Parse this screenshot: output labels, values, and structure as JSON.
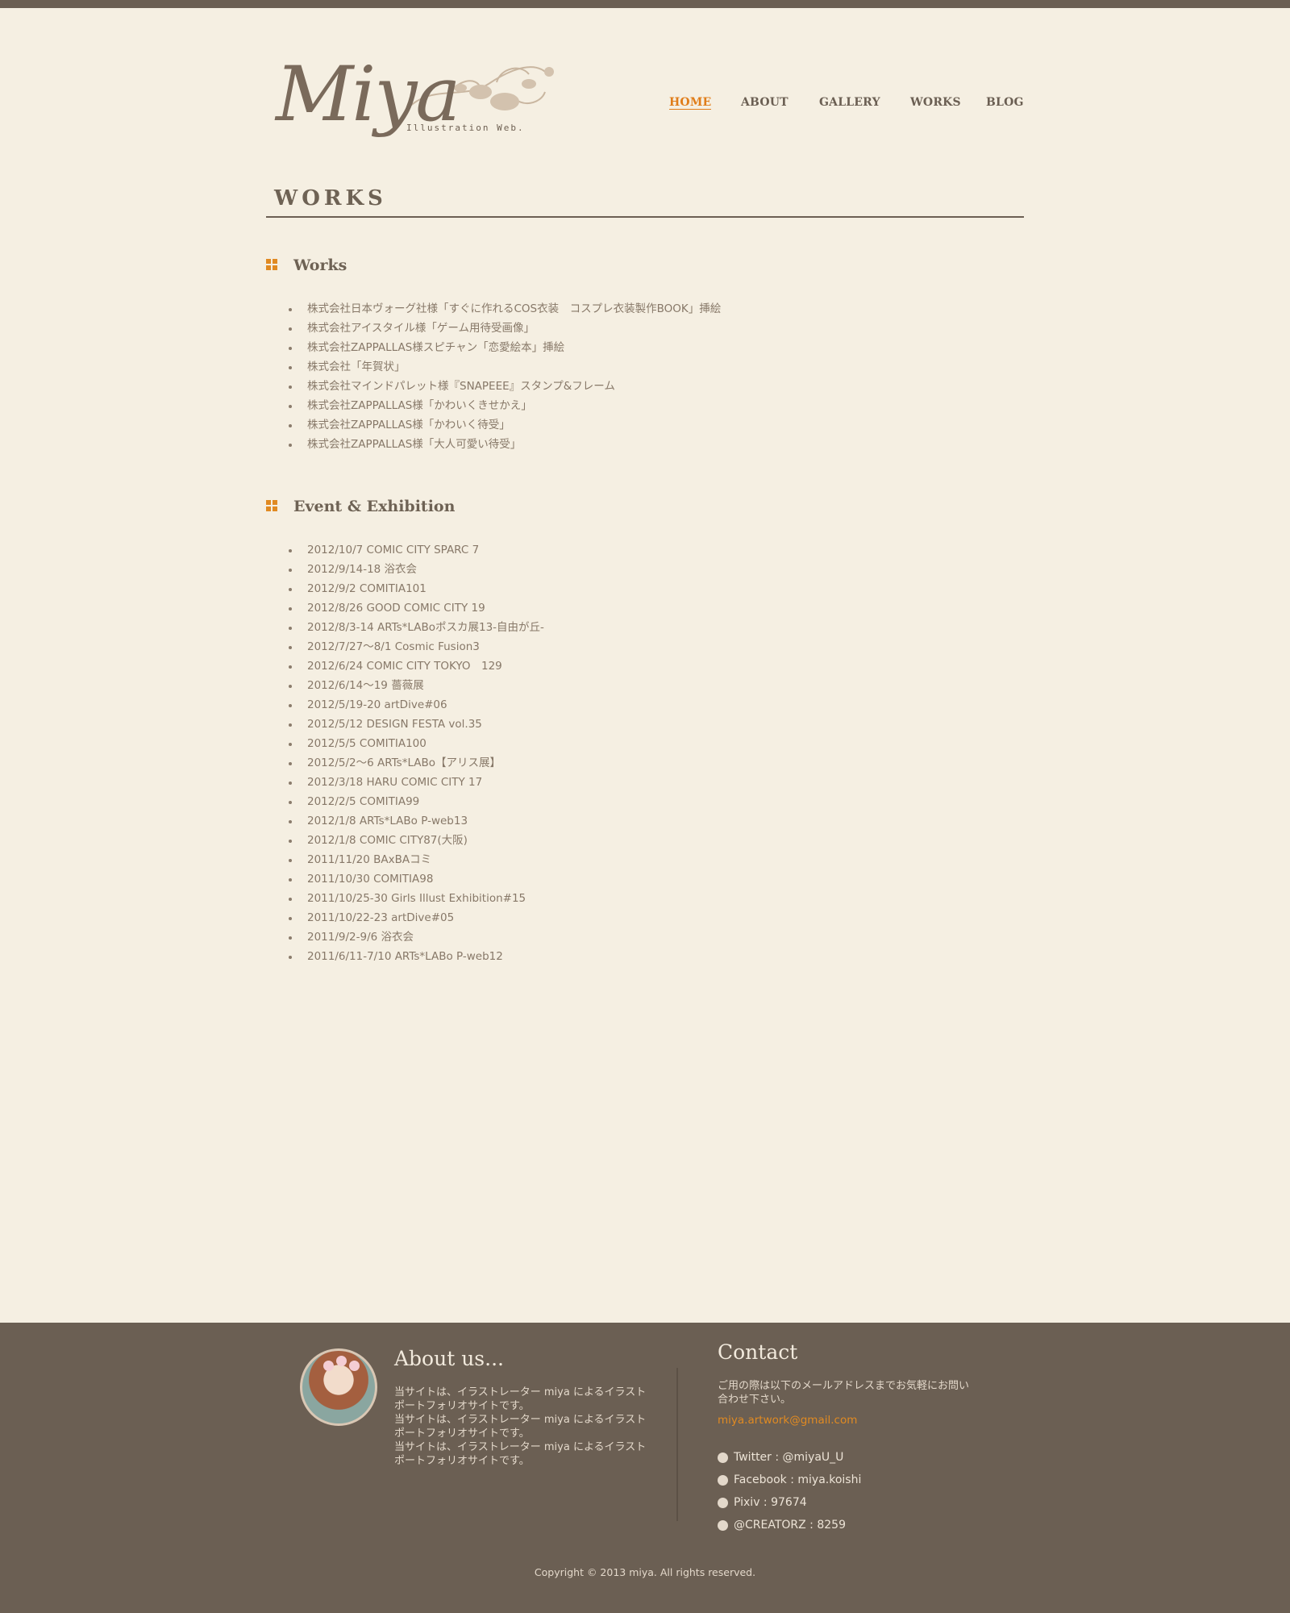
{
  "header": {
    "logo_text": "Miya",
    "logo_subtitle": "Illustration Web."
  },
  "nav": [
    {
      "label": "HOME",
      "active": true
    },
    {
      "label": "ABOUT",
      "active": false
    },
    {
      "label": "GALLERY",
      "active": false
    },
    {
      "label": "WORKS",
      "active": false
    },
    {
      "label": "BLOG",
      "active": false
    }
  ],
  "page_title": "WORKS",
  "sections": [
    {
      "title": "Works",
      "items": [
        "株式会社日本ヴォーグ社様「すぐに作れるCOS衣装　コスプレ衣装製作BOOK」挿絵",
        "株式会社アイスタイル様「ゲーム用待受画像」",
        "株式会社ZAPPALLAS様スピチャン「恋愛絵本」挿絵",
        "株式会社「年賀状」",
        "株式会社マインドパレット様『SNAPEEE』スタンプ&フレーム",
        "株式会社ZAPPALLAS様「かわいくきせかえ」",
        "株式会社ZAPPALLAS様「かわいく待受」",
        "株式会社ZAPPALLAS様「大人可愛い待受」"
      ]
    },
    {
      "title": "Event & Exhibition",
      "items": [
        "2012/10/7 COMIC CITY SPARC 7",
        "2012/9/14-18 浴衣会",
        "2012/9/2  COMITIA101",
        "2012/8/26 GOOD COMIC CITY 19",
        "2012/8/3-14 ARTs*LABoポスカ展13-自由が丘-",
        "2012/7/27～8/1 Cosmic Fusion3",
        "2012/6/24 COMIC CITY TOKYO　129",
        "2012/6/14～19 薔薇展",
        "2012/5/19-20 artDive#06",
        "2012/5/12 DESIGN FESTA vol.35",
        "2012/5/5 COMITIA100",
        "2012/5/2～6 ARTs*LABo【アリス展】",
        "2012/3/18 HARU COMIC CITY 17",
        "2012/2/5 COMITIA99",
        "2012/1/8 ARTs*LABo P-web13",
        "2012/1/8 COMIC CITY87(大阪)",
        "2011/11/20 BAxBAコミ",
        "2011/10/30 COMITIA98",
        "2011/10/25-30 Girls Illust Exhibition#15",
        "2011/10/22-23 artDive#05",
        "2011/9/2-9/6 浴衣会",
        "2011/6/11-7/10 ARTs*LABo P-web12"
      ]
    }
  ],
  "footer": {
    "about_title": "About us...",
    "about_text": [
      "当サイトは、イラストレーター miya によるイラストポートフォリオサイトです。",
      "当サイトは、イラストレーター miya によるイラストポートフォリオサイトです。",
      "当サイトは、イラストレーター miya によるイラストポートフォリオサイトです。"
    ],
    "contact_title": "Contact",
    "contact_text": "ご用の際は以下のメールアドレスまでお気軽にお問い合わせ下さい。",
    "email": "miya.artwork@gmail.com",
    "social": [
      "Twitter : @miyaU_U",
      "Facebook : miya.koishi",
      "Pixiv : 97674",
      "@CREATORZ : 8259"
    ],
    "copyright": "Copyright © 2013 miya. All rights reserved."
  },
  "colors": {
    "background": "#f5efe2",
    "text": "#8b7c6c",
    "accent": "#e07d1a",
    "footer": "#6b5f53"
  }
}
